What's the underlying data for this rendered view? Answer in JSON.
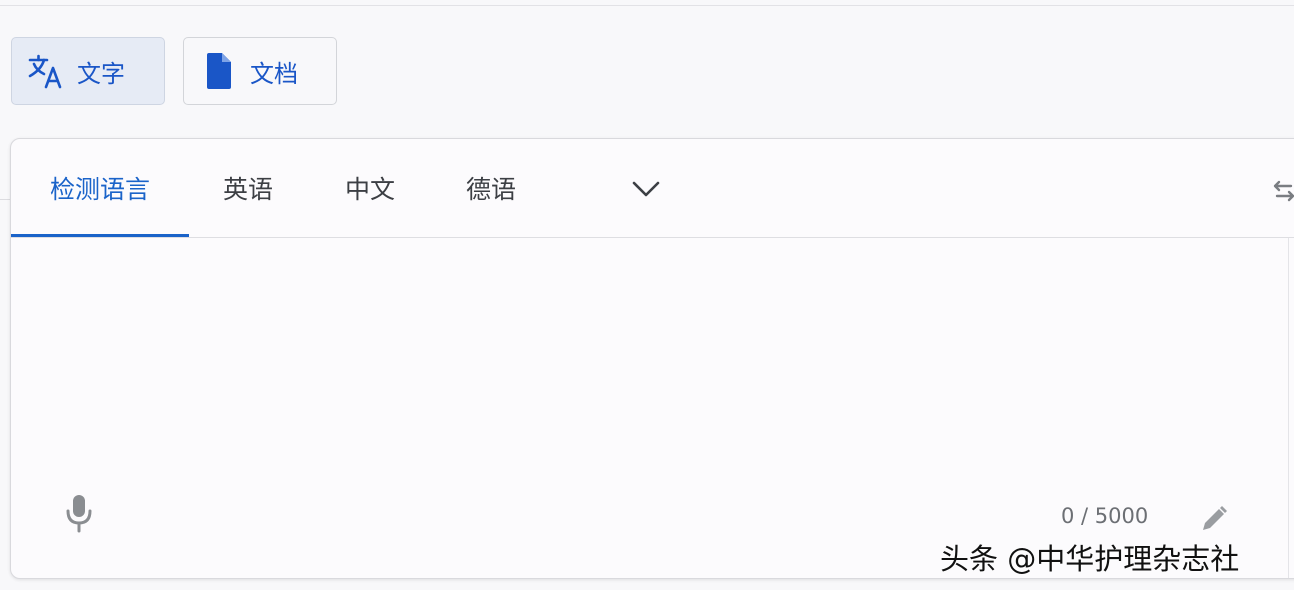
{
  "mode_buttons": {
    "text": {
      "label": "文字",
      "icon": "translate-icon",
      "active": true
    },
    "document": {
      "label": "文档",
      "icon": "document-icon",
      "active": false
    }
  },
  "source_langs": {
    "tabs": [
      {
        "label": "检测语言",
        "active": true
      },
      {
        "label": "英语",
        "active": false
      },
      {
        "label": "中文",
        "active": false
      },
      {
        "label": "德语",
        "active": false
      }
    ],
    "more_icon": "chevron-down-icon",
    "swap_icon": "swap-languages-icon"
  },
  "input": {
    "value": "",
    "mic_icon": "microphone-icon",
    "char_count": "0 / 5000",
    "pencil_icon": "pencil-icon"
  },
  "watermark": "头条 @中华护理杂志社",
  "colors": {
    "accent": "#1a63c9",
    "active_button_bg": "#e6ebf5",
    "page_bg": "#f8f8fa"
  }
}
